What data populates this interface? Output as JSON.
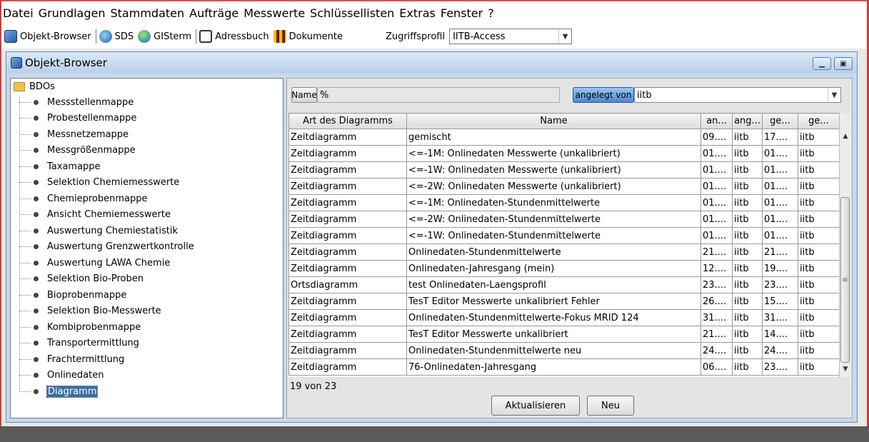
{
  "menu": [
    "Datei",
    "Grundlagen",
    "Stammdaten",
    "Aufträge",
    "Messwerte",
    "Schlüssellisten",
    "Extras",
    "Fenster",
    "?"
  ],
  "toolbar": {
    "objekt_browser": "Objekt-Browser",
    "sds": "SDS",
    "gisterm": "GISterm",
    "adressbuch": "Adressbuch",
    "dokumente": "Dokumente",
    "zugriffsprofil_label": "Zugriffsprofil",
    "zugriffsprofil_value": "IITB-Access"
  },
  "window": {
    "title": "Objekt-Browser",
    "minimize_icon": "minimize-icon",
    "maximize_icon": "maximize-icon"
  },
  "tree": {
    "root": "BDOs",
    "items": [
      "Messstellenmappe",
      "Probestellenmappe",
      "Messnetzemappe",
      "Messgrößenmappe",
      "Taxamappe",
      "Selektion Chemiemesswerte",
      "Chemieprobenmappe",
      "Ansicht Chemiemesswerte",
      "Auswertung Chemiestatistik",
      "Auswertung Grenzwertkontrolle",
      "Auswertung LAWA Chemie",
      "Selektion Bio-Proben",
      "Bioprobenmappe",
      "Selektion Bio-Messwerte",
      "Kombiprobenmappe",
      "Transportermittlung",
      "Frachtermittlung",
      "Onlinedaten",
      "Diagramm"
    ],
    "selected": "Diagramm"
  },
  "filter": {
    "name_button": "Name",
    "name_value": "%",
    "angelegt_button": "angelegt von",
    "angelegt_value": "iitb"
  },
  "table": {
    "headers": [
      "Art des Diagramms",
      "Name",
      "an...",
      "ang...",
      "ge...",
      "ge..."
    ],
    "rows": [
      [
        "Zeitdiagramm",
        "gemischt",
        "09....",
        "iitb",
        "17....",
        "iitb"
      ],
      [
        "Zeitdiagramm",
        "<=-1M: Onlinedaten Messwerte (unkalibriert)",
        "01....",
        "iitb",
        "01....",
        "iitb"
      ],
      [
        "Zeitdiagramm",
        "<=-1W: Onlinedaten Messwerte (unkalibriert)",
        "01....",
        "iitb",
        "01....",
        "iitb"
      ],
      [
        "Zeitdiagramm",
        "<=-2W: Onlinedaten Messwerte (unkalibriert)",
        "01....",
        "iitb",
        "01....",
        "iitb"
      ],
      [
        "Zeitdiagramm",
        "<=-1M: Onlinedaten-Stundenmittelwerte",
        "01....",
        "iitb",
        "01....",
        "iitb"
      ],
      [
        "Zeitdiagramm",
        "<=-2W: Onlinedaten-Stundenmittelwerte",
        "01....",
        "iitb",
        "01....",
        "iitb"
      ],
      [
        "Zeitdiagramm",
        "<=-1W: Onlinedaten-Stundenmittelwerte",
        "01....",
        "iitb",
        "01....",
        "iitb"
      ],
      [
        "Zeitdiagramm",
        "Onlinedaten-Stundenmittelwerte",
        "21....",
        "iitb",
        "21....",
        "iitb"
      ],
      [
        "Zeitdiagramm",
        "Onlinedaten-Jahresgang (mein)",
        "12....",
        "iitb",
        "19....",
        "iitb"
      ],
      [
        "Ortsdiagramm",
        "test Onlinedaten-Laengsprofil",
        "23....",
        "iitb",
        "23....",
        "iitb"
      ],
      [
        "Zeitdiagramm",
        "TesT Editor Messwerte unkalibriert  Fehler",
        "26....",
        "iitb",
        "15....",
        "iitb"
      ],
      [
        "Zeitdiagramm",
        "Onlinedaten-Stundenmittelwerte-Fokus MRID 124",
        "31....",
        "iitb",
        "31....",
        "iitb"
      ],
      [
        "Zeitdiagramm",
        "TesT Editor Messwerte unkalibriert",
        "21....",
        "iitb",
        "14....",
        "iitb"
      ],
      [
        "Zeitdiagramm",
        "Onlinedaten-Stundenmittelwerte neu",
        "24....",
        "iitb",
        "24....",
        "iitb"
      ],
      [
        "Zeitdiagramm",
        "76-Onlinedaten-Jahresgang",
        "06....",
        "iitb",
        "23....",
        "iitb"
      ]
    ]
  },
  "count_text": "19 von 23",
  "buttons": {
    "aktualisieren": "Aktualisieren",
    "neu": "Neu"
  },
  "colors": {
    "selection": "#3a6ea5",
    "window_frame": "#c6d9ee",
    "active_filter": "#4a86cf"
  }
}
